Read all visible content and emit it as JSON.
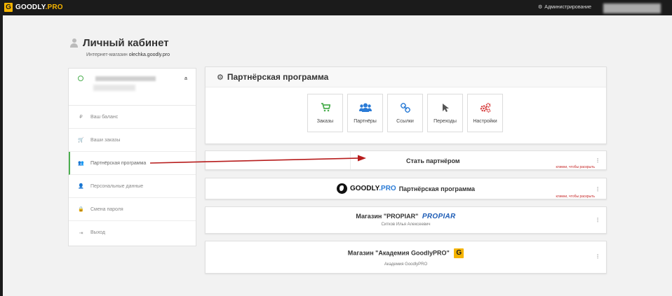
{
  "topbar": {
    "logo_text": "GOODLY",
    "logo_pro": ".PRO",
    "admin_label": "Администрирование",
    "admin_icon": "gear-icon"
  },
  "header": {
    "title": "Личный кабинет",
    "subtitle_prefix": "Интернет-магазин",
    "subtitle_domain": "olechka.goodly.pro"
  },
  "sidebar": {
    "profile_name_suffix": "а",
    "items": [
      {
        "icon": "ruble-icon",
        "glyph": "₽",
        "label": "Ваш баланс"
      },
      {
        "icon": "cart-icon",
        "glyph": "🛒",
        "label": "Ваши заказы"
      },
      {
        "icon": "users-icon",
        "glyph": "👥",
        "label": "Партнёрская программа"
      },
      {
        "icon": "user-icon",
        "glyph": "👤",
        "label": "Персональные данные"
      },
      {
        "icon": "lock-icon",
        "glyph": "🔒",
        "label": "Смена пароля"
      },
      {
        "icon": "signout-icon",
        "glyph": "⇥",
        "label": "Выход"
      }
    ]
  },
  "panel": {
    "title": "Партнёрская программа",
    "tiles": [
      {
        "icon": "cart-icon",
        "glyph": "🛒",
        "color": "#4caf50",
        "label": "Заказы"
      },
      {
        "icon": "users-icon",
        "glyph": "👥",
        "color": "#2a7bd6",
        "label": "Партнёры"
      },
      {
        "icon": "link-icon",
        "glyph": "🔗",
        "color": "#2a7bd6",
        "label": "Ссылки"
      },
      {
        "icon": "cursor-icon",
        "glyph": "➤",
        "color": "#555555",
        "label": "Переходы"
      },
      {
        "icon": "gears-icon",
        "glyph": "⚙",
        "color": "#d32f2f",
        "label": "Настройки"
      }
    ]
  },
  "cards": {
    "become_partner": "Стать партнёром",
    "click_hint": "кликни, чтобы раскрыть",
    "goodly_logo": "GOODLY",
    "goodly_pro": ".PRO",
    "goodly_program": "Партнёрская программа",
    "click_hint_2": "кликни, чтобы раскрыть",
    "shop1_title": "Магазин \"PROPIAR\"",
    "shop1_logo": "PROPIAR",
    "shop1_owner": "Ситков Илья Алексеевич",
    "shop2_title": "Магазин \"Академия GoodlyPRO\"",
    "shop2_badge": "G",
    "shop2_owner": "Академия GoodlyPRO"
  },
  "colors": {
    "accent_green": "#4caf50",
    "brand_yellow": "#f5b400",
    "arrow_red": "#b71c1c",
    "hint_red": "#c62828"
  }
}
